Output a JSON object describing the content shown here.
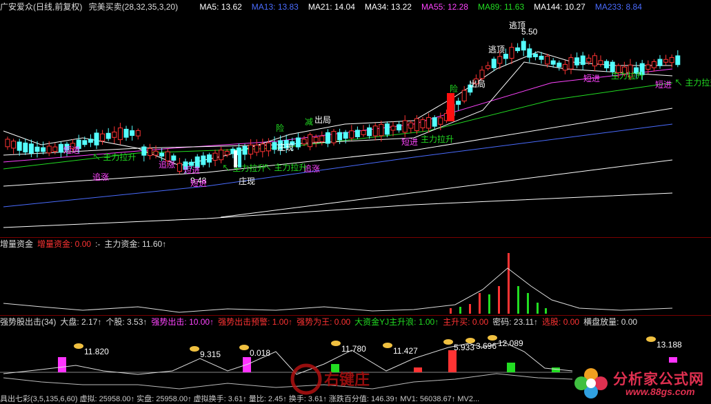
{
  "main": {
    "header": {
      "title": "广安爱众(日线,前复权)",
      "indicator": "完美买卖(28,32,35,3,20)",
      "mas": [
        {
          "label": "MA5: 13.62",
          "color": "#ffffff"
        },
        {
          "label": "MA13: 13.83",
          "color": "#4a6cff"
        },
        {
          "label": "MA21: 14.04",
          "color": "#ffffff"
        },
        {
          "label": "MA34: 13.22",
          "color": "#ffffff"
        },
        {
          "label": "MA55: 12.28",
          "color": "#ff44ff"
        },
        {
          "label": "MA89: 11.63",
          "color": "#22dd22"
        },
        {
          "label": "MA144: 10.27",
          "color": "#ffffff"
        },
        {
          "label": "MA233: 8.84",
          "color": "#4a6cff"
        }
      ]
    },
    "annotations": [
      {
        "text": "逃顶",
        "color": "#ffffff"
      },
      {
        "text": "5.50",
        "color": "#ffffff"
      },
      {
        "text": "逃顶",
        "color": "#ffffff"
      },
      {
        "text": "出局",
        "color": "#ffffff"
      },
      {
        "text": "出局",
        "color": "#ffffff"
      },
      {
        "text": "险",
        "color": "#22dd22"
      },
      {
        "text": "减",
        "color": "#22dd22"
      },
      {
        "text": "险",
        "color": "#22dd22"
      },
      {
        "text": "庄现",
        "color": "#ffffff"
      },
      {
        "text": "庄现",
        "color": "#ffffff"
      },
      {
        "text": "9.48",
        "color": "#ffffff"
      },
      {
        "text": "短进",
        "color": "#ff44ff"
      },
      {
        "text": "追涨",
        "color": "#ff44ff"
      },
      {
        "text": "短进",
        "color": "#ff44ff"
      },
      {
        "text": "追涨",
        "color": "#ff44ff"
      },
      {
        "text": "追涨",
        "color": "#ff44ff"
      },
      {
        "text": "短进",
        "color": "#ff44ff"
      },
      {
        "text": "短进",
        "color": "#ff44ff"
      },
      {
        "text": "短进",
        "color": "#ff44ff"
      },
      {
        "text": "↖ 主力拉升",
        "color": "#22dd22"
      },
      {
        "text": "↖ 主力拉升",
        "color": "#22dd22"
      },
      {
        "text": "↖ 主力拉升",
        "color": "#22dd22"
      },
      {
        "text": "主力拉升",
        "color": "#22dd22"
      },
      {
        "text": "主力拉升",
        "color": "#22dd22"
      },
      {
        "text": "↖ 主力拉升",
        "color": "#22dd22"
      },
      {
        "text": "短进",
        "color": "#ff44ff"
      }
    ]
  },
  "mid": {
    "header": [
      {
        "label": "增量资金",
        "color": "#dddddd"
      },
      {
        "label": "增量资金: 0.00",
        "color": "#ff3333"
      },
      {
        "label": ":-",
        "color": "#dddddd"
      },
      {
        "label": "主力资金: 11.60↑",
        "color": "#dddddd"
      }
    ]
  },
  "bottom": {
    "header": [
      {
        "label": "强势股出击(34)",
        "color": "#dddddd"
      },
      {
        "label": "大盘: 2.17↑",
        "color": "#dddddd"
      },
      {
        "label": "个股: 3.53↑",
        "color": "#dddddd"
      },
      {
        "label": "强势出击: 10.00↑",
        "color": "#ff44ff"
      },
      {
        "label": "强势出击预警: 1.00↑",
        "color": "#ff3333"
      },
      {
        "label": "强势为王: 0.00",
        "color": "#ff3333"
      },
      {
        "label": "大资金YJ主升浪: 1.00↑",
        "color": "#22dd22"
      },
      {
        "label": "主升买: 0.00",
        "color": "#ff3333"
      },
      {
        "label": "密码: 23.11↑",
        "color": "#dddddd"
      },
      {
        "label": "选股: 0.00",
        "color": "#ff3333"
      },
      {
        "label": "横盘放量: 0.00",
        "color": "#dddddd"
      }
    ],
    "labels": [
      "11.820",
      "9.315",
      "0.018",
      "11.780",
      "11.427",
      "5.933",
      "3.696",
      "12.089",
      "13.188"
    ],
    "footer": "具出七彩(3,5,135,6,60) 虚拟: 25958.00↑ 实盘: 25958.00↑ 虚拟换手: 3.61↑ 量比: 2.45↑ 换手: 3.61↑ 涨跌百分值: 146.39↑ MV1: 56038.67↑ MV2..."
  },
  "watermark": {
    "brand": "分析家公式网",
    "url": "www.88gs.com",
    "center_mark": "右键庄"
  }
}
